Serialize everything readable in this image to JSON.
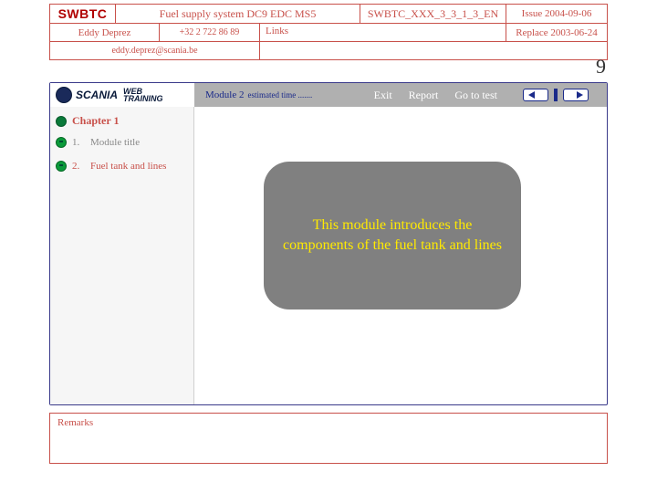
{
  "header": {
    "logo_text": "SWBTC",
    "title": "Fuel supply system DC9 EDC MS5",
    "code": "SWBTC_XXX_3_3_1_3_EN",
    "issue": "Issue 2004-09-06",
    "author": "Eddy Deprez",
    "phone": "+32 2 722 86 89",
    "links_label": "Links",
    "replace": "Replace 2003-06-24",
    "email": "eddy.deprez@scania.be"
  },
  "page_number": "9",
  "topbar": {
    "brand": "SCANIA",
    "web_line1": "WEB",
    "web_line2": "TRAINING",
    "module_label": "Module 2",
    "estimated": "estimated time .......",
    "exit": "Exit",
    "report": "Report",
    "gotest": "Go to test"
  },
  "sidebar": {
    "chapter": "Chapter 1",
    "items": [
      {
        "num": "1.",
        "label": "Module title",
        "active": false
      },
      {
        "num": "2.",
        "label": "Fuel tank and lines",
        "active": true
      }
    ]
  },
  "callout_text": "This module introduces the components of the fuel tank and lines",
  "remarks_label": "Remarks"
}
